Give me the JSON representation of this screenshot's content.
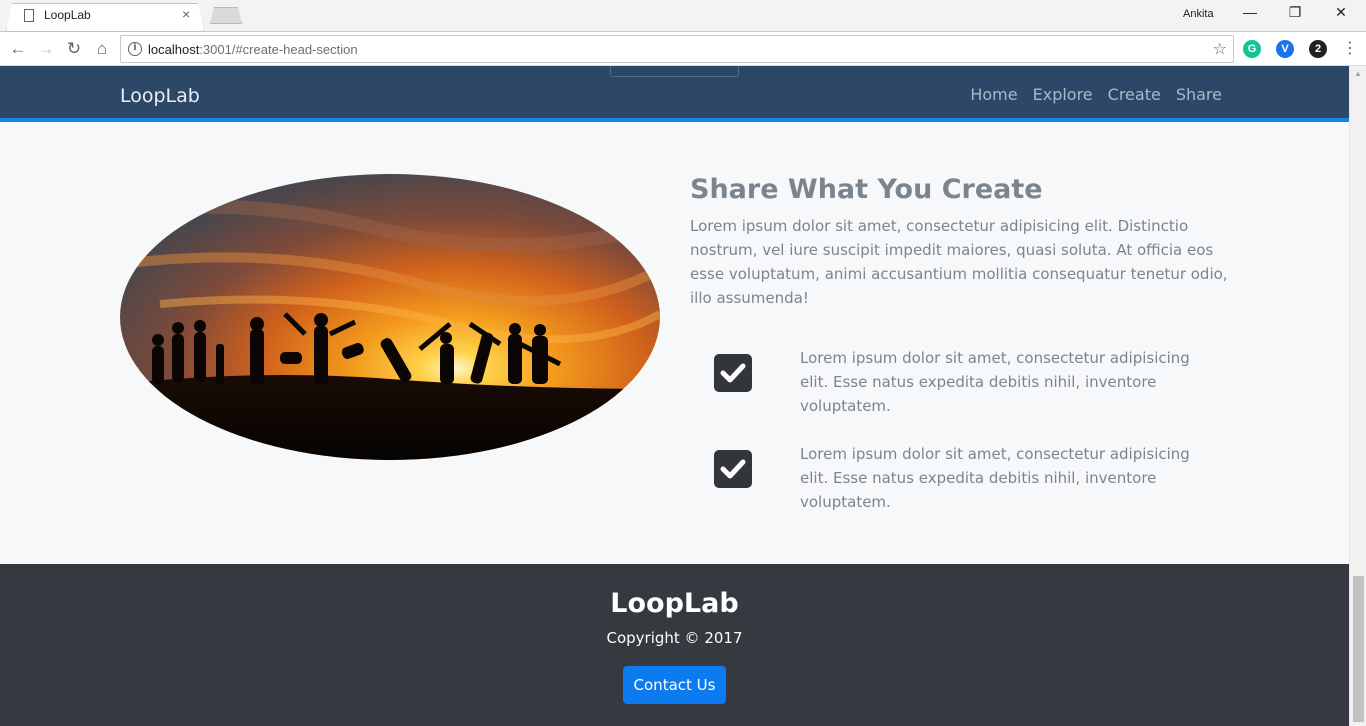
{
  "browser": {
    "tab_title": "LoopLab",
    "tab_close": "×",
    "profile_name": "Ankita",
    "url_host": "localhost",
    "url_rest": ":3001/#create-head-section",
    "window_controls": {
      "minimize": "—",
      "restore": "❐",
      "close": "✕"
    },
    "extensions": [
      {
        "name": "grammarly-icon",
        "glyph": "G",
        "color": "#15c39a"
      },
      {
        "name": "vpn-icon",
        "glyph": "V",
        "color": "#1a73e8"
      },
      {
        "name": "extension-badge-icon",
        "glyph": "2",
        "color": "#202124"
      }
    ]
  },
  "navbar": {
    "brand": "LoopLab",
    "links": [
      "Home",
      "Explore",
      "Create",
      "Share"
    ]
  },
  "section": {
    "heading": "Share What You Create",
    "lead": "Lorem ipsum dolor sit amet, consectetur adipisicing elit. Distinctio nostrum, vel iure suscipit impedit maiores, quasi soluta. At officia eos esse voluptatum, animi accusantium mollitia consequatur tenetur odio, illo assumenda!",
    "features": [
      {
        "text": "Lorem ipsum dolor sit amet, consectetur adipisicing elit. Esse natus expedita debitis nihil, inventore voluptatem."
      },
      {
        "text": "Lorem ipsum dolor sit amet, consectetur adipisicing elit. Esse natus expedita debitis nihil, inventore voluptatem."
      }
    ]
  },
  "footer": {
    "brand": "LoopLab",
    "copyright": "Copyright © 2017",
    "contact_label": "Contact Us"
  },
  "colors": {
    "navbar_bg": "#2c4866",
    "navbar_accent": "#1686e0",
    "footer_bg": "#343a40",
    "button_primary": "#0d7bf0"
  }
}
